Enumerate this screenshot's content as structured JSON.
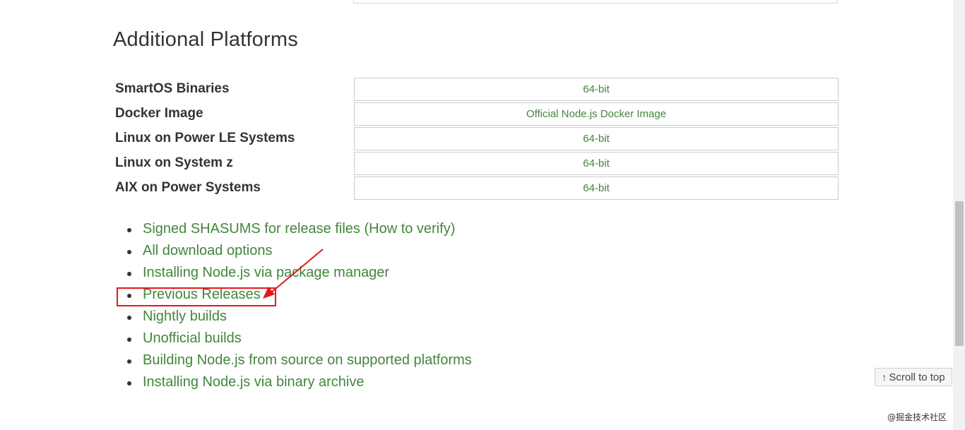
{
  "section": {
    "title": "Additional Platforms"
  },
  "platforms": [
    {
      "label": "SmartOS Binaries",
      "link": "64-bit"
    },
    {
      "label": "Docker Image",
      "link": "Official Node.js Docker Image"
    },
    {
      "label": "Linux on Power LE Systems",
      "link": "64-bit"
    },
    {
      "label": "Linux on System z",
      "link": "64-bit"
    },
    {
      "label": "AIX on Power Systems",
      "link": "64-bit"
    }
  ],
  "links": [
    "Signed SHASUMS for release files (How to verify)",
    "All download options",
    "Installing Node.js via package manager",
    "Previous Releases",
    "Nightly builds",
    "Unofficial builds",
    "Building Node.js from source on supported platforms",
    "Installing Node.js via binary archive"
  ],
  "scroll_to_top": {
    "icon": "↑",
    "label": "Scroll to top"
  },
  "watermark": "@掘金技术社区",
  "colors": {
    "link": "#43853d",
    "annotation": "#e3191b",
    "text": "#333333"
  },
  "icons": {
    "scroll_arrow": "up-arrow-icon",
    "annotation_arrow": "red-arrow-icon"
  }
}
